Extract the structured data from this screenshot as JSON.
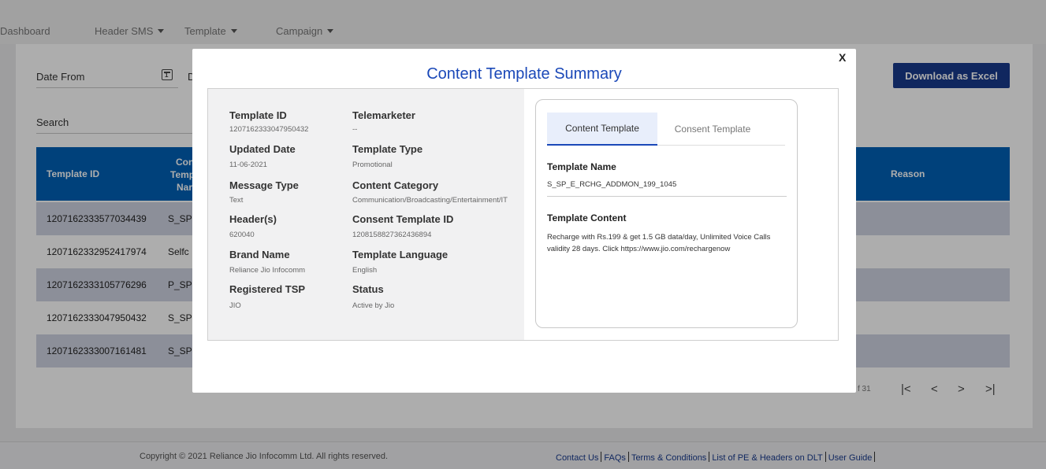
{
  "nav": {
    "items": [
      {
        "label": "Dashboard",
        "dropdown": false
      },
      {
        "label": "Header SMS",
        "dropdown": true
      },
      {
        "label": "Template",
        "dropdown": true
      },
      {
        "label": "Campaign",
        "dropdown": true
      }
    ]
  },
  "filters": {
    "date_from_label": "Date From",
    "date_to_partial": "D",
    "search_label": "Search",
    "download_button": "Download as Excel"
  },
  "table": {
    "headers": {
      "template_id": "Template ID",
      "content_name_l1": "Cont",
      "content_name_l2": "Temp",
      "content_name_l3": "Nar",
      "reason": "Reason"
    },
    "rows": [
      {
        "id": "1207162333577034439",
        "name": "S_SP"
      },
      {
        "id": "1207162332952417974",
        "name": "Selfc"
      },
      {
        "id": "1207162333105776296",
        "name": "P_SP"
      },
      {
        "id": "1207162333047950432",
        "name": "S_SP"
      },
      {
        "id": "1207162333007161481",
        "name": "S_SP"
      }
    ],
    "row_colors": {
      "odd": "#cfd3e2",
      "even": "#ffffff"
    }
  },
  "pagination": {
    "page_info": "f 31",
    "first": "|<",
    "prev": "<",
    "next": ">",
    "last": ">|"
  },
  "footer": {
    "copyright": "Copyright © 2021 Reliance Jio Infocomm Ltd. All rights reserved.",
    "links": [
      "Contact Us",
      "FAQs",
      "Terms & Conditions",
      "List of PE & Headers on DLT",
      "User Guide"
    ]
  },
  "modal": {
    "title": "Content Template Summary",
    "close_label": "X",
    "fields": {
      "template_id": {
        "label": "Template ID",
        "value": "1207162333047950432"
      },
      "telemarketer": {
        "label": "Telemarketer",
        "value": "--"
      },
      "updated_date": {
        "label": "Updated Date",
        "value": "11-06-2021"
      },
      "template_type": {
        "label": "Template Type",
        "value": "Promotional"
      },
      "message_type": {
        "label": "Message Type",
        "value": "Text"
      },
      "content_category": {
        "label": "Content Category",
        "value": "Communication/Broadcasting/Entertainment/IT"
      },
      "headers": {
        "label": "Header(s)",
        "value": "620040"
      },
      "consent_template_id": {
        "label": "Consent Template ID",
        "value": "1208158827362436894"
      },
      "brand_name": {
        "label": "Brand Name",
        "value": "Reliance Jio Infocomm"
      },
      "template_language": {
        "label": "Template Language",
        "value": "English"
      },
      "registered_tsp": {
        "label": "Registered TSP",
        "value": "JIO"
      },
      "status": {
        "label": "Status",
        "value": "Active by Jio"
      }
    },
    "tabs": {
      "content": "Content Template",
      "consent": "Consent Template"
    },
    "template_name_label": "Template Name",
    "template_name": "S_SP_E_RCHG_ADDMON_199_1045",
    "template_content_label": "Template Content",
    "template_content": "Recharge with Rs.199 & get 1.5 GB data/day, Unlimited Voice Calls validity 28 days. Click https://www.jio.com/rechargenow"
  },
  "colors": {
    "brand_blue": "#183a8d",
    "table_header": "#0160b5",
    "modal_title": "#1a48b8"
  }
}
